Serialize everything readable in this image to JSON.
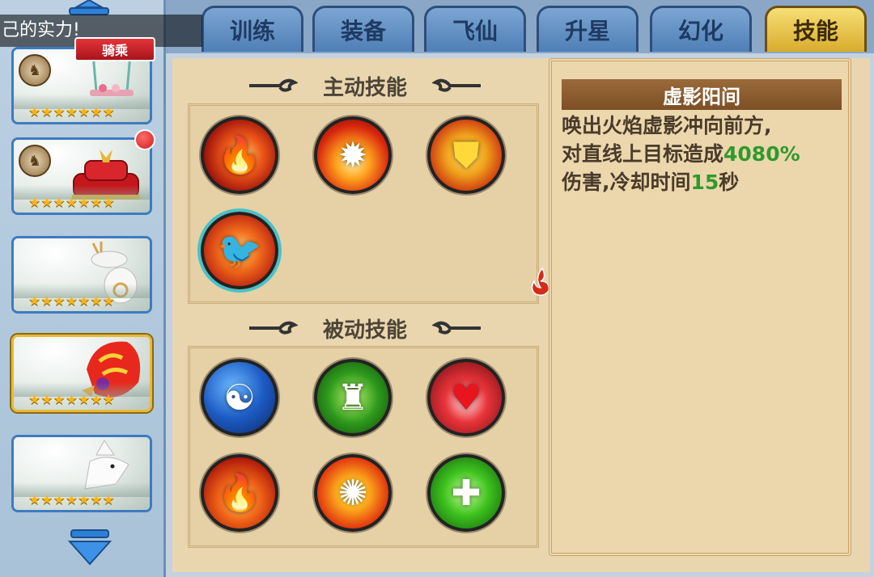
{
  "banner": {
    "text": "己的实力!"
  },
  "left": {
    "riding_tag": "骑乘",
    "cards": [
      {
        "stars": "★★★★★★★",
        "selected": false
      },
      {
        "stars": "★★★★★★★",
        "selected": false
      },
      {
        "stars": "★★★★★★★",
        "selected": false
      },
      {
        "stars": "★★★★★★★",
        "selected": true
      },
      {
        "stars": "★★★★★★★",
        "selected": false
      }
    ]
  },
  "tabs": [
    "训练",
    "装备",
    "飞仙",
    "升星",
    "幻化",
    "技能"
  ],
  "active_tab": "技能",
  "sections": {
    "active_title": "主动技能",
    "passive_title": "被动技能"
  },
  "detail": {
    "name": "虚影阳间",
    "desc_1": "唤出火焰虚影冲向前方,",
    "desc_2a": "对直线上目标造成",
    "damage": "4080%",
    "desc_3a": "伤害,冷却时间",
    "cooldown": "15",
    "desc_3b": "秒"
  },
  "icons": {
    "active": [
      "fire-swirl-icon",
      "fire-burst-icon",
      "flame-shield-icon",
      "phoenix-icon"
    ],
    "passive": [
      "yin-yang-icon",
      "body-shield-icon",
      "heart-icon",
      "flame-wall-icon",
      "explosion-icon",
      "heal-cross-icon"
    ]
  }
}
